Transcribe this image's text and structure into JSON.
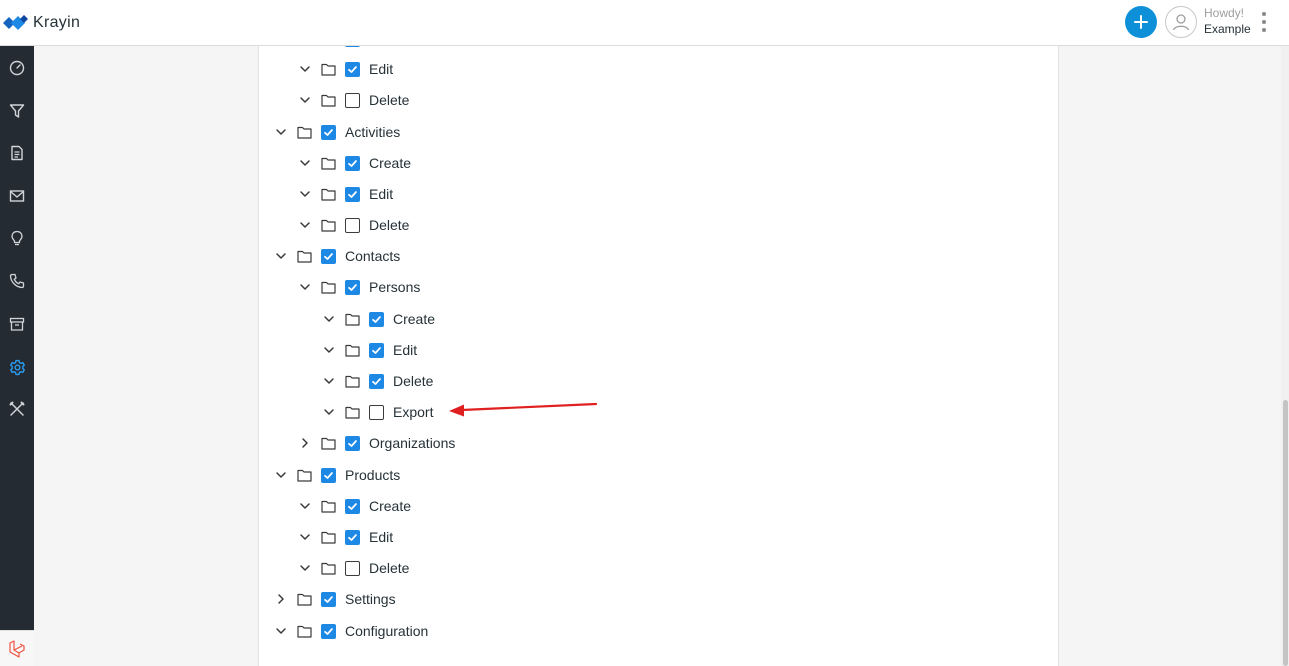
{
  "app": {
    "name": "Krayin"
  },
  "header": {
    "greeting": "Howdy!",
    "user_name": "Example"
  },
  "sidebar": {
    "items": [
      {
        "icon": "dashboard-icon"
      },
      {
        "icon": "filter-icon"
      },
      {
        "icon": "document-icon"
      },
      {
        "icon": "mail-icon"
      },
      {
        "icon": "lightbulb-icon"
      },
      {
        "icon": "phone-icon"
      },
      {
        "icon": "archive-icon"
      },
      {
        "icon": "settings-gear-icon",
        "active": true
      },
      {
        "icon": "tools-icon"
      }
    ]
  },
  "colors": {
    "accent": "#1e88e5",
    "sidebar": "#242b33",
    "annotation": "#e02020"
  },
  "tree": [
    {
      "label": "",
      "level": 2,
      "checked": true,
      "expanded": true
    },
    {
      "label": "Edit",
      "level": 2,
      "checked": true,
      "expanded": true
    },
    {
      "label": "Delete",
      "level": 2,
      "checked": false,
      "expanded": true
    },
    {
      "label": "Activities",
      "level": 1,
      "checked": true,
      "expanded": true
    },
    {
      "label": "Create",
      "level": 2,
      "checked": true,
      "expanded": true
    },
    {
      "label": "Edit",
      "level": 2,
      "checked": true,
      "expanded": true
    },
    {
      "label": "Delete",
      "level": 2,
      "checked": false,
      "expanded": true
    },
    {
      "label": "Contacts",
      "level": 1,
      "checked": true,
      "expanded": true
    },
    {
      "label": "Persons",
      "level": 2,
      "checked": true,
      "expanded": true
    },
    {
      "label": "Create",
      "level": 3,
      "checked": true,
      "expanded": true
    },
    {
      "label": "Edit",
      "level": 3,
      "checked": true,
      "expanded": true
    },
    {
      "label": "Delete",
      "level": 3,
      "checked": true,
      "expanded": true
    },
    {
      "label": "Export",
      "level": 3,
      "checked": false,
      "expanded": true
    },
    {
      "label": "Organizations",
      "level": 2,
      "checked": true,
      "expanded": false
    },
    {
      "label": "Products",
      "level": 1,
      "checked": true,
      "expanded": true
    },
    {
      "label": "Create",
      "level": 2,
      "checked": true,
      "expanded": true
    },
    {
      "label": "Edit",
      "level": 2,
      "checked": true,
      "expanded": true
    },
    {
      "label": "Delete",
      "level": 2,
      "checked": false,
      "expanded": true
    },
    {
      "label": "Settings",
      "level": 1,
      "checked": true,
      "expanded": false
    },
    {
      "label": "Configuration",
      "level": 1,
      "checked": true,
      "expanded": true
    }
  ]
}
